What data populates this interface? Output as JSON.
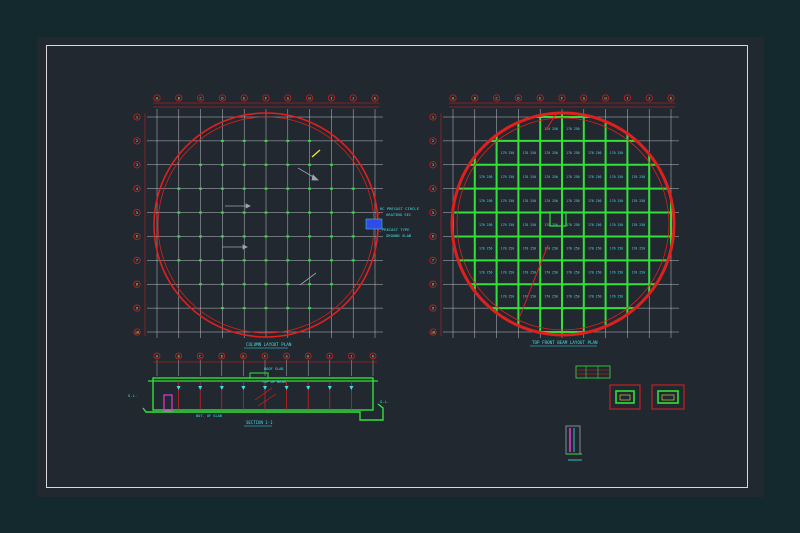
{
  "colors": {
    "background": "#13292e",
    "sheet": "#212830",
    "frame": "#d8d8d8",
    "grid": "#cfd4d8",
    "red": "#e0201e",
    "green": "#33e03a",
    "cyan": "#3ee0e6",
    "blue": "#2f4be8",
    "magenta": "#e23ad6",
    "yellow": "#e6e23a"
  },
  "plan_left": {
    "title": "COLUMN LAYOUT PLAN",
    "col_labels": [
      "A",
      "B",
      "C",
      "D",
      "E",
      "F",
      "G",
      "H",
      "I",
      "J",
      "K"
    ],
    "row_labels": [
      "1",
      "2",
      "3",
      "4",
      "5",
      "6",
      "7",
      "8",
      "9",
      "10"
    ],
    "callout_1": "RC PRECAST CIRCLE",
    "callout_2": "GRATING SEC",
    "callout_3": "PRECAST TYPE",
    "callout_4": "GROUND SLAB"
  },
  "plan_right": {
    "title": "TOP FRONT BEAM LAYOUT PLAN",
    "col_labels": [
      "A",
      "B",
      "C",
      "D",
      "E",
      "F",
      "G",
      "H",
      "I",
      "J",
      "K"
    ],
    "row_labels": [
      "1",
      "2",
      "3",
      "4",
      "5",
      "6",
      "7",
      "8",
      "9",
      "10"
    ],
    "panel_label": "170 250"
  },
  "section": {
    "title": "SECTION 1-1",
    "col_labels": [
      "A",
      "B",
      "C",
      "D",
      "E",
      "F",
      "G",
      "H",
      "I",
      "J",
      "K"
    ],
    "note_1": "ROOF SLAB",
    "note_2": "TOP OF BEAM",
    "note_3": "BOT. OF SLAB",
    "level_left": "G.L.",
    "level_right": "G.L."
  }
}
